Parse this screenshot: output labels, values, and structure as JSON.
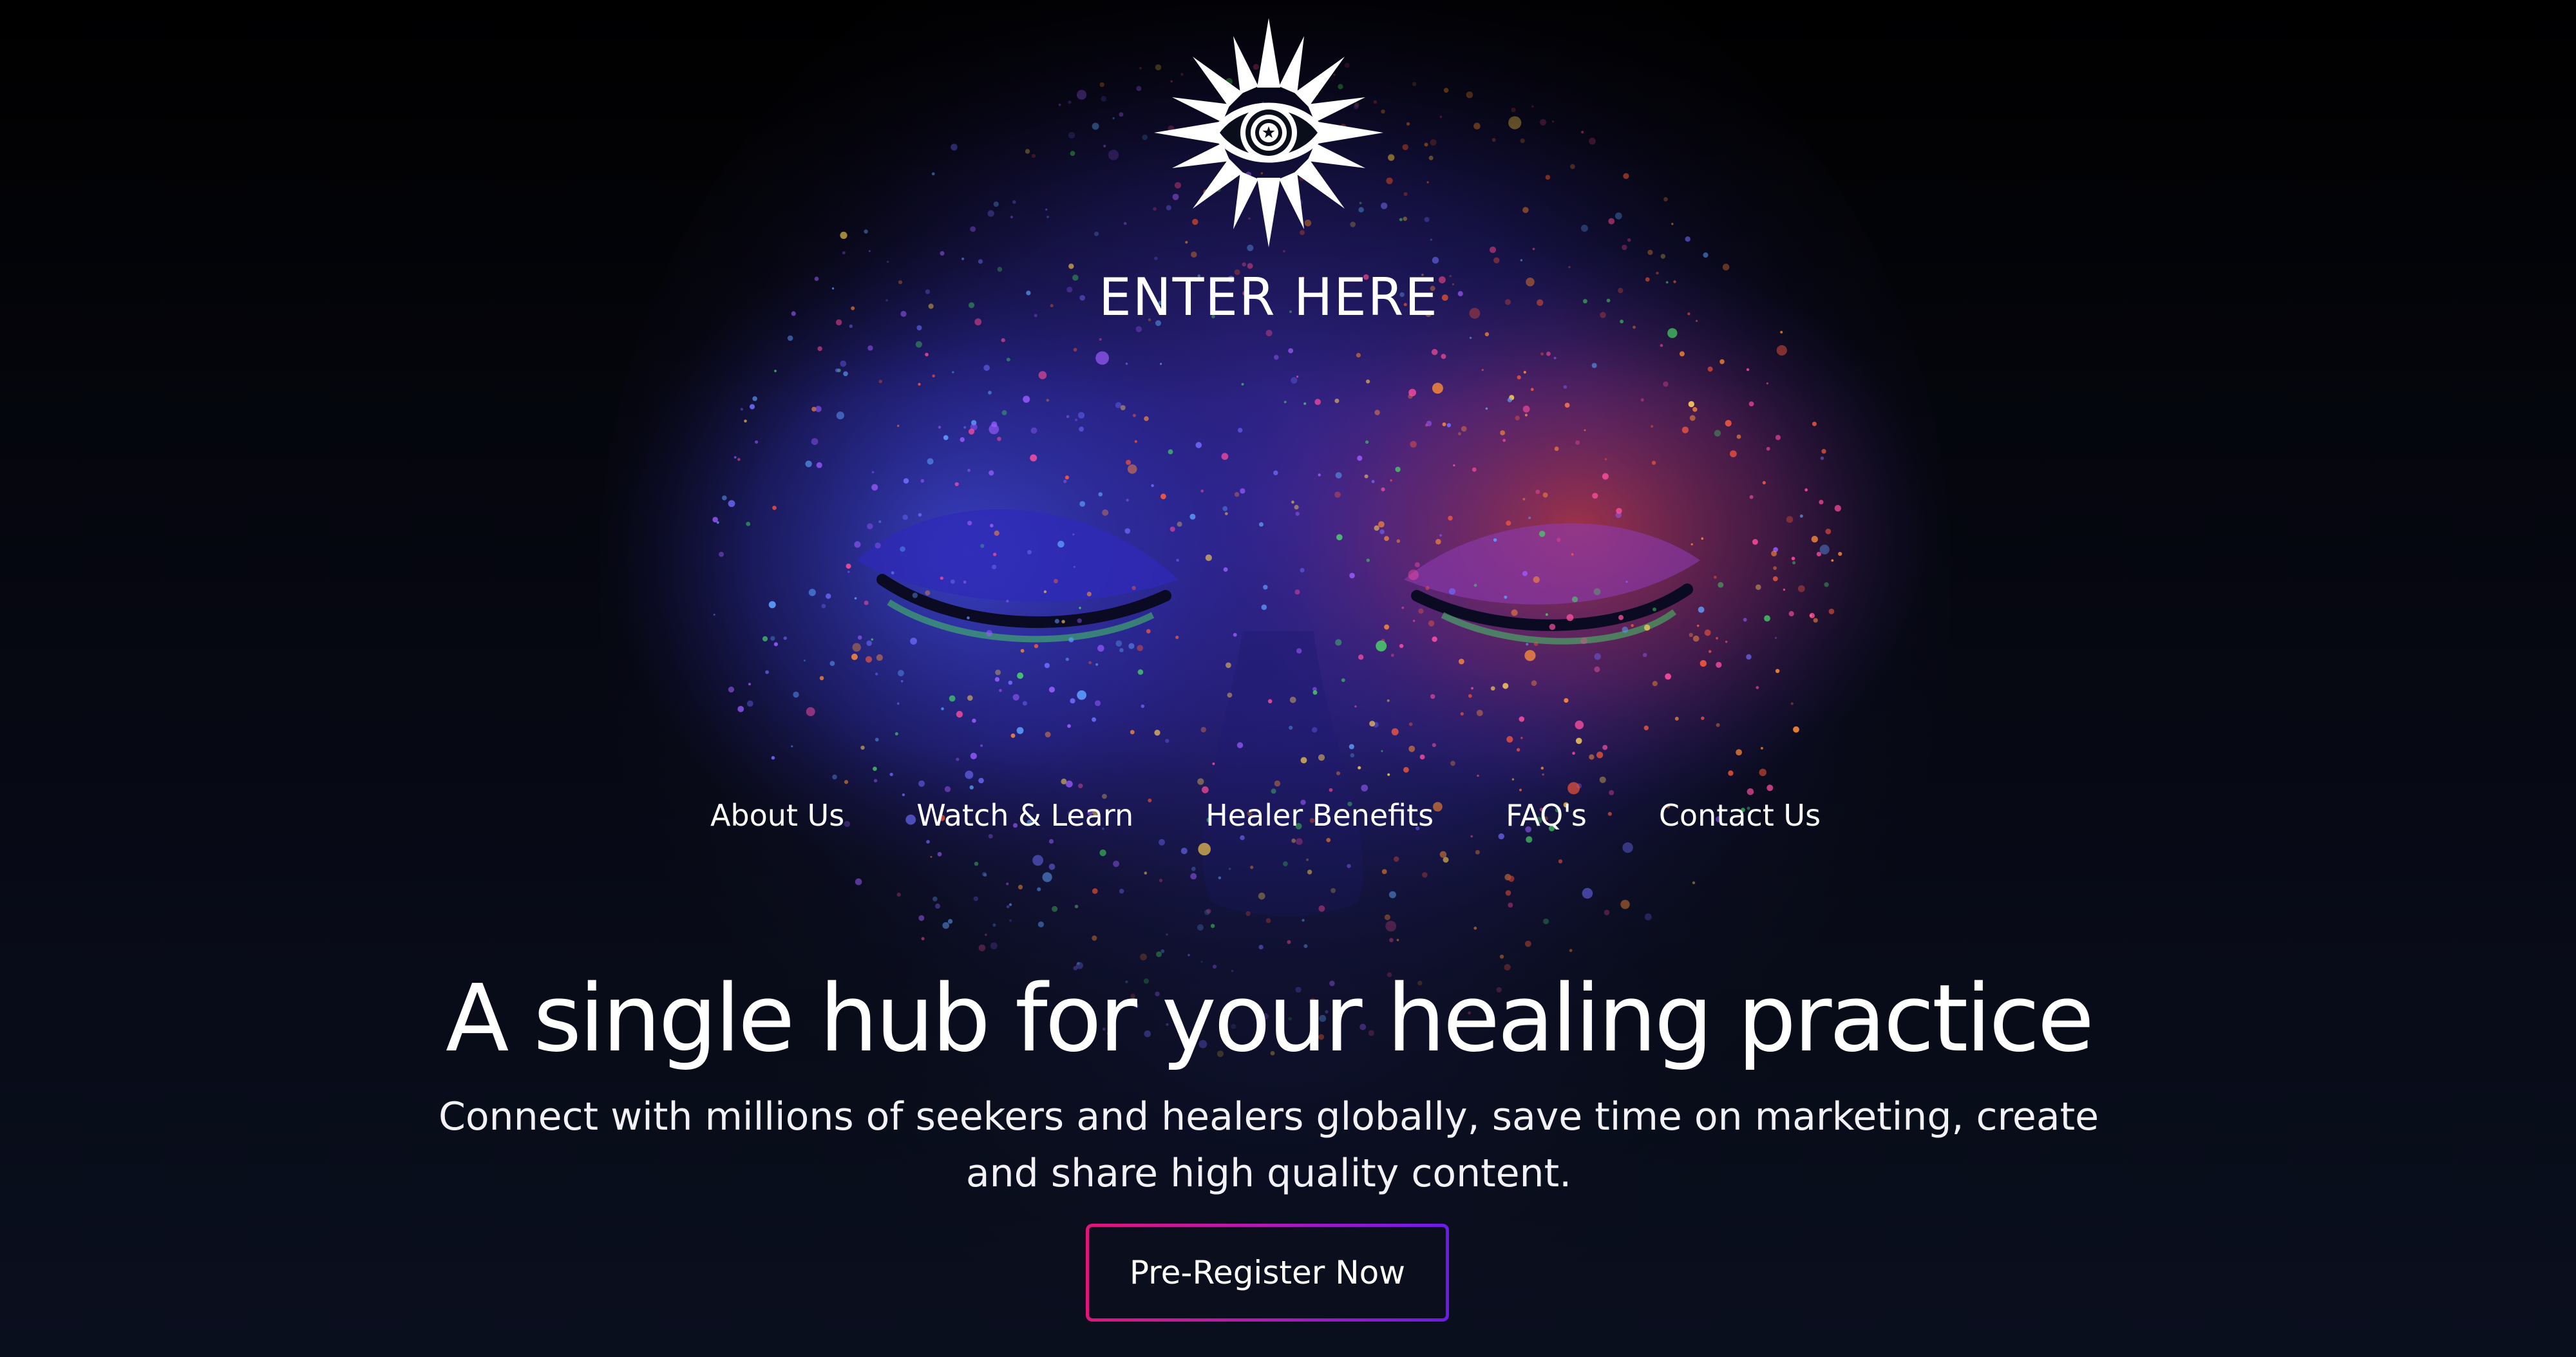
{
  "brand": {
    "name": "ENTER HERE",
    "logo_icon": "eye-sunburst-icon"
  },
  "nav": {
    "items": [
      {
        "label": "About Us"
      },
      {
        "label": "Watch & Learn"
      },
      {
        "label": "Healer Benefits"
      },
      {
        "label": "FAQ's"
      },
      {
        "label": "Contact Us"
      }
    ]
  },
  "hero": {
    "headline": "A single hub for your healing practice",
    "subtext": "Connect with millions of seekers and healers globally, save time on marketing, create and share high quality content.",
    "background_image": "face-with-neon-paint-speckles-eyes-closed"
  },
  "cta": {
    "label": "Pre-Register Now"
  },
  "colors": {
    "background": "#05070c",
    "text": "#ffffff",
    "cta_gradient_start": "#e0157a",
    "cta_gradient_end": "#6b1be8",
    "cta_fill": "#0b0f1d"
  }
}
